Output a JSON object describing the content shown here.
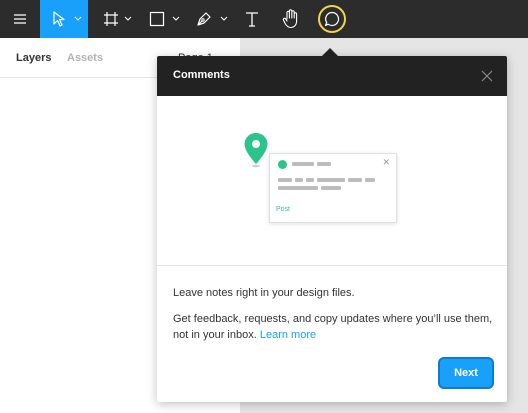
{
  "toolbar": {
    "icons": [
      "menu-icon",
      "move-icon",
      "frame-icon",
      "shape-icon",
      "pen-icon",
      "text-icon",
      "hand-icon",
      "comment-icon"
    ],
    "accent": "#18a0fb",
    "highlight_ring": "#f3d44a"
  },
  "left_panel": {
    "tabs": [
      {
        "label": "Layers"
      },
      {
        "label": "Assets"
      }
    ],
    "page_label": "Page 1"
  },
  "popover": {
    "title": "Comments",
    "line1": "Leave notes right in your design files.",
    "line2": "Get feedback, requests, and copy updates where you’ll use them, not in your inbox.",
    "learn_more": "Learn more",
    "next_label": "Next",
    "illustration": {
      "post_label": "Post",
      "pin_color": "#2bc48a"
    }
  }
}
